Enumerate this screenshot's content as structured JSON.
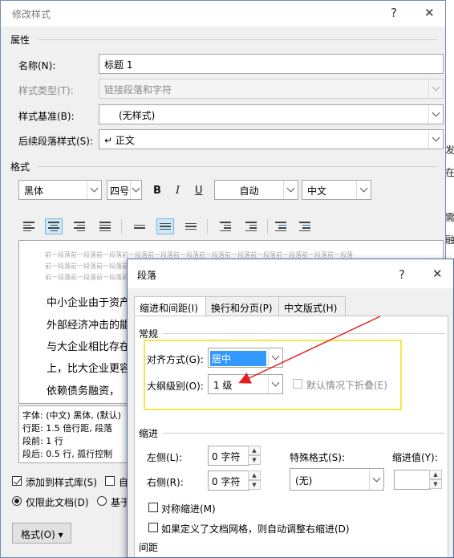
{
  "background_doc": {
    "chars": [
      "发",
      "在",
      "需",
      "融"
    ]
  },
  "main_dialog": {
    "title": "修改样式",
    "help_label": "?",
    "close_label": "✕",
    "properties": {
      "section_title": "属性",
      "name_label": "名称(N):",
      "name_value": "标题 1",
      "style_type_label": "样式类型(T):",
      "style_type_value": "链接段落和字符",
      "style_based_label": "样式基准(B):",
      "style_based_value": "(无样式)",
      "next_style_label": "后续段落样式(S):",
      "next_style_value": "↵ 正文"
    },
    "format": {
      "section_title": "格式",
      "font": "黑体",
      "size": "四号",
      "bold": "B",
      "italic": "I",
      "underline": "U",
      "color": "自动",
      "language": "中文"
    },
    "preview": {
      "prev_line": "前一段落前一段落前一段落前一段落前一段落前一段落前一段落前一段落前一段落前一段落前一段落前一段落",
      "lines": [
        "中小企业由于资产",
        "外部经济冲击的能",
        "与大企业相比存在",
        "上，比大企业更容",
        " 依赖债务融资，"
      ]
    },
    "description": {
      "lines": [
        "字体: (中文) 黑体, (默认)",
        "  行距: 1.5 倍行距, 段落",
        "  段前: 1 行",
        "  段后: 0.5 行, 孤行控制"
      ]
    },
    "add_to_gallery_label": "添加到样式库(S)",
    "auto_update_label": "自",
    "only_this_doc_label": "仅限此文档(D)",
    "based_on_template_label": "基于",
    "format_button": "格式(O) ▾"
  },
  "paragraph_dialog": {
    "title": "段落",
    "help_label": "?",
    "close_label": "✕",
    "tabs": [
      {
        "label": "缩进和间距(I)",
        "active": true
      },
      {
        "label": "换行和分页(P)",
        "active": false
      },
      {
        "label": "中文版式(H)",
        "active": false
      }
    ],
    "general": {
      "section_title": "常规",
      "alignment_label": "对齐方式(G):",
      "alignment_value": "居中",
      "outline_label": "大纲级别(O):",
      "outline_value": "1 级",
      "collapse_label": "默认情况下折叠(E)"
    },
    "indent": {
      "section_title": "缩进",
      "left_label": "左侧(L):",
      "left_value": "0 字符",
      "right_label": "右侧(R):",
      "right_value": "0 字符",
      "special_label": "特殊格式(S):",
      "special_value": "(无)",
      "indent_value_label": "缩进值(Y):",
      "indent_value": "",
      "mirror_label": "对称缩进(M)",
      "auto_adjust_label": "如果定义了文档网格，则自动调整右缩进(D)"
    },
    "spacing": {
      "section_title": "间距"
    }
  },
  "annotation": {
    "highlight_color": "#f3e84a",
    "arrow_color": "#e02020"
  },
  "colors": {
    "accent": "#0078d7",
    "selection": "#3399ff"
  }
}
